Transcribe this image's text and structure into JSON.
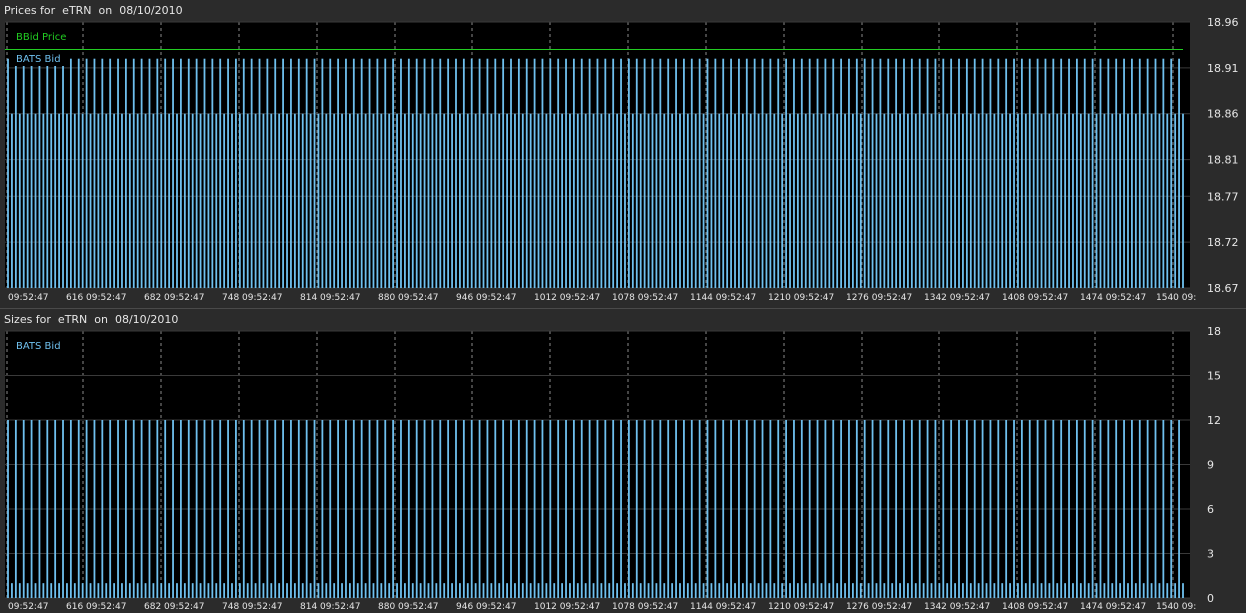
{
  "prices_panel": {
    "title": "Prices for  eTRN  on  08/10/2010"
  },
  "sizes_panel": {
    "title": "Sizes for  eTRN  on  08/10/2010"
  },
  "colors": {
    "background": "#2b2b2b",
    "plot_bg": "#000000",
    "bats_bid": "#6fc0ee",
    "bbid": "#22cc22",
    "grid": "#8a8a8a"
  },
  "chart_data": [
    {
      "type": "bar",
      "title": "Prices for  eTRN  on  08/10/2010",
      "ylim": [
        18.67,
        18.96
      ],
      "yticks": [
        "18.96",
        "18.91",
        "18.86",
        "18.81",
        "18.77",
        "18.72",
        "18.67"
      ],
      "xticks": [
        "09:52:47",
        "616 09:52:47",
        "682 09:52:47",
        "748 09:52:47",
        "814 09:52:47",
        "880 09:52:47",
        "946 09:52:47",
        "1012 09:52:47",
        "1078 09:52:47",
        "1144 09:52:47",
        "1210 09:52:47",
        "1276 09:52:47",
        "1342 09:52:47",
        "1408 09:52:47",
        "1474 09:52:47",
        "1540 09:"
      ],
      "legend": "top-left",
      "grid": true,
      "series": [
        {
          "name": "BBid Price",
          "type": "line",
          "constant": 18.93
        },
        {
          "name": "BATS Bid",
          "type": "bar",
          "pattern": [
            18.92,
            18.86
          ],
          "bar_count": 300
        }
      ]
    },
    {
      "type": "bar",
      "title": "Sizes for  eTRN  on  08/10/2010",
      "ylim": [
        0,
        18
      ],
      "yticks": [
        "18",
        "15",
        "12",
        "9",
        "6",
        "3",
        "0"
      ],
      "xticks": [
        "09:52:47",
        "616 09:52:47",
        "682 09:52:47",
        "748 09:52:47",
        "814 09:52:47",
        "880 09:52:47",
        "946 09:52:47",
        "1012 09:52:47",
        "1078 09:52:47",
        "1144 09:52:47",
        "1210 09:52:47",
        "1276 09:52:47",
        "1342 09:52:47",
        "1408 09:52:47",
        "1474 09:52:47",
        "1540 09:"
      ],
      "legend": "top-left",
      "grid": true,
      "series": [
        {
          "name": "BATS Bid",
          "type": "bar",
          "pattern": [
            12,
            1
          ],
          "bar_count": 300
        }
      ]
    }
  ]
}
